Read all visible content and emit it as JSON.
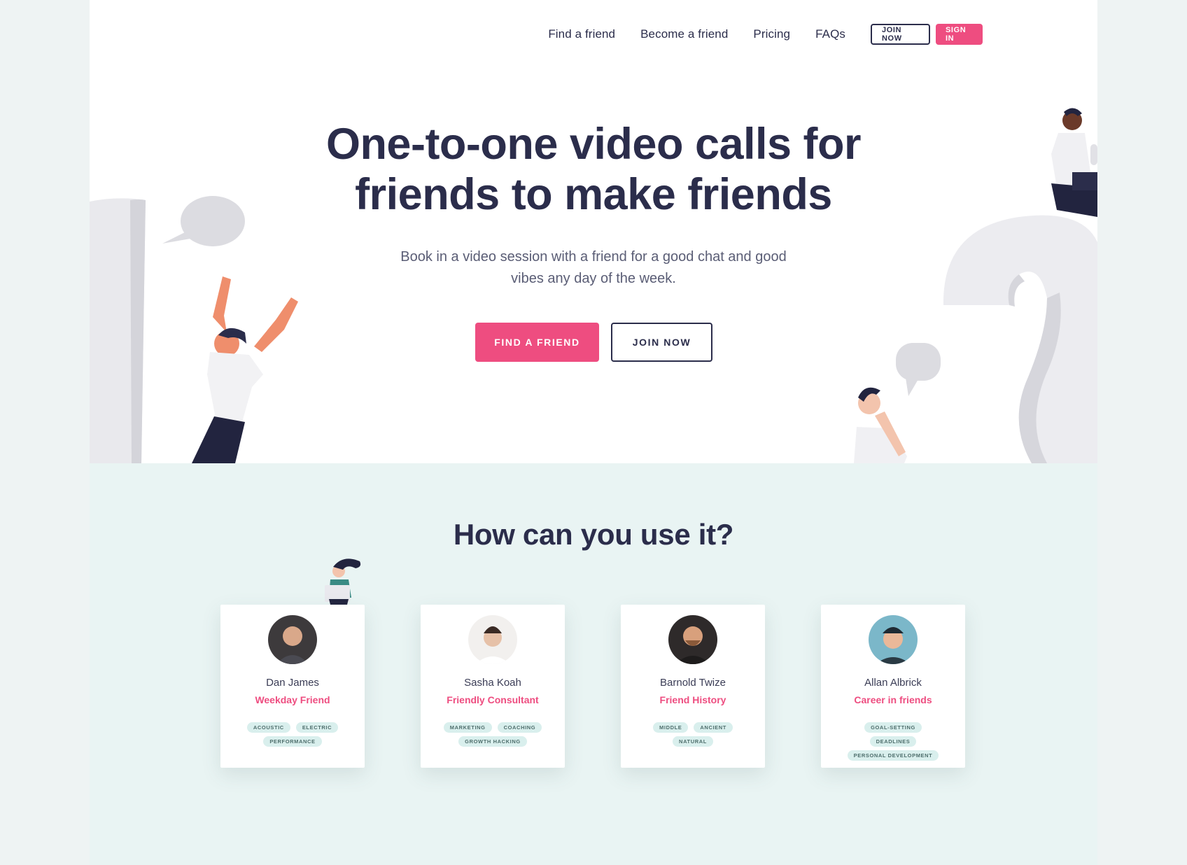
{
  "nav": {
    "links": [
      "Find a friend",
      "Become a friend",
      "Pricing",
      "FAQs"
    ],
    "join_label": "JOIN NOW",
    "signin_label": "SIGN IN"
  },
  "hero": {
    "title_line1": "One-to-one video calls for",
    "title_line2": "friends to make friends",
    "subtitle_line1": "Book in a video session with a friend for a good chat and good",
    "subtitle_line2": "vibes any day of the week.",
    "cta_primary": "FIND A FRIEND",
    "cta_secondary": "JOIN NOW"
  },
  "section": {
    "title": "How can you use it?"
  },
  "cards": [
    {
      "name": "Dan James",
      "role": "Weekday Friend",
      "tags": [
        "ACOUSTIC",
        "ELECTRIC",
        "PERFORMANCE"
      ],
      "avatar_bg": "#3d3a3c"
    },
    {
      "name": "Sasha Koah",
      "role": "Friendly Consultant",
      "tags": [
        "MARKETING",
        "COACHING",
        "GROWTH HACKING"
      ],
      "avatar_bg": "#f2f0ee"
    },
    {
      "name": "Barnold Twize",
      "role": "Friend History",
      "tags": [
        "MIDDLE",
        "ANCIENT",
        "NATURAL"
      ],
      "avatar_bg": "#2e2a2a"
    },
    {
      "name": "Allan Albrick",
      "role": "Career in friends",
      "tags": [
        "GOAL-SETTING",
        "DEADLINES",
        "PERSONAL DEVELOPMENT"
      ],
      "avatar_bg": "#7bb7c9"
    }
  ],
  "colors": {
    "accent": "#ee4d80",
    "navy": "#2b2d4b",
    "section_bg": "#e9f4f3",
    "tag_bg": "#d9efed"
  }
}
